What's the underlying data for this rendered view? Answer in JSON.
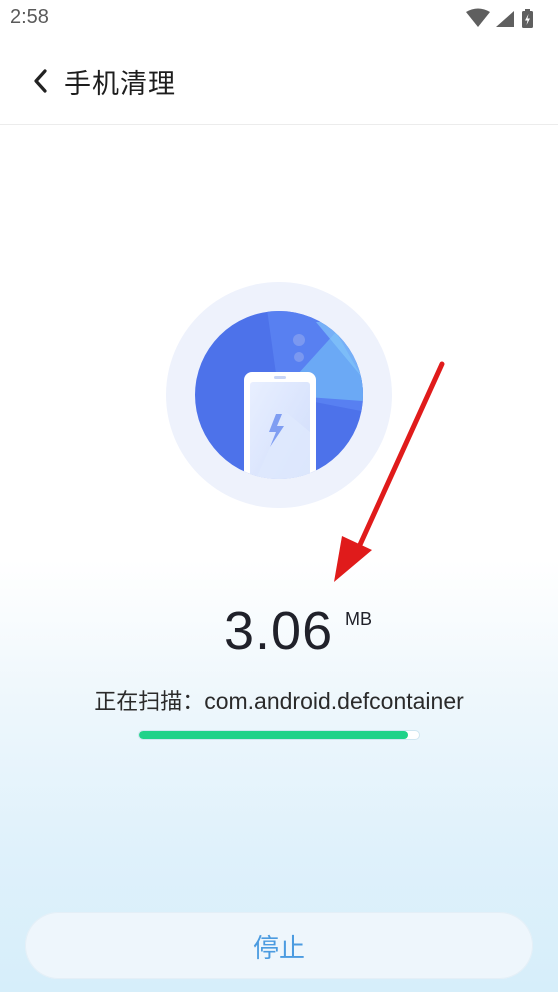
{
  "status_bar": {
    "time": "2:58",
    "icons": [
      "wifi-icon",
      "cellular-signal-icon",
      "battery-charging-icon"
    ]
  },
  "header": {
    "back_icon": "chevron-left-icon",
    "title": "手机清理"
  },
  "scan": {
    "size_value": "3.06",
    "size_unit": "MB",
    "label": "正在扫描：",
    "package": "com.android.defcontainer",
    "progress_fraction": 0.96
  },
  "actions": {
    "stop_label": "停止"
  },
  "colors": {
    "accent_green": "#1ed28a",
    "primary_blue": "#4b74ea",
    "stop_text": "#4b9be0",
    "annotation_red": "#e01b1b"
  }
}
